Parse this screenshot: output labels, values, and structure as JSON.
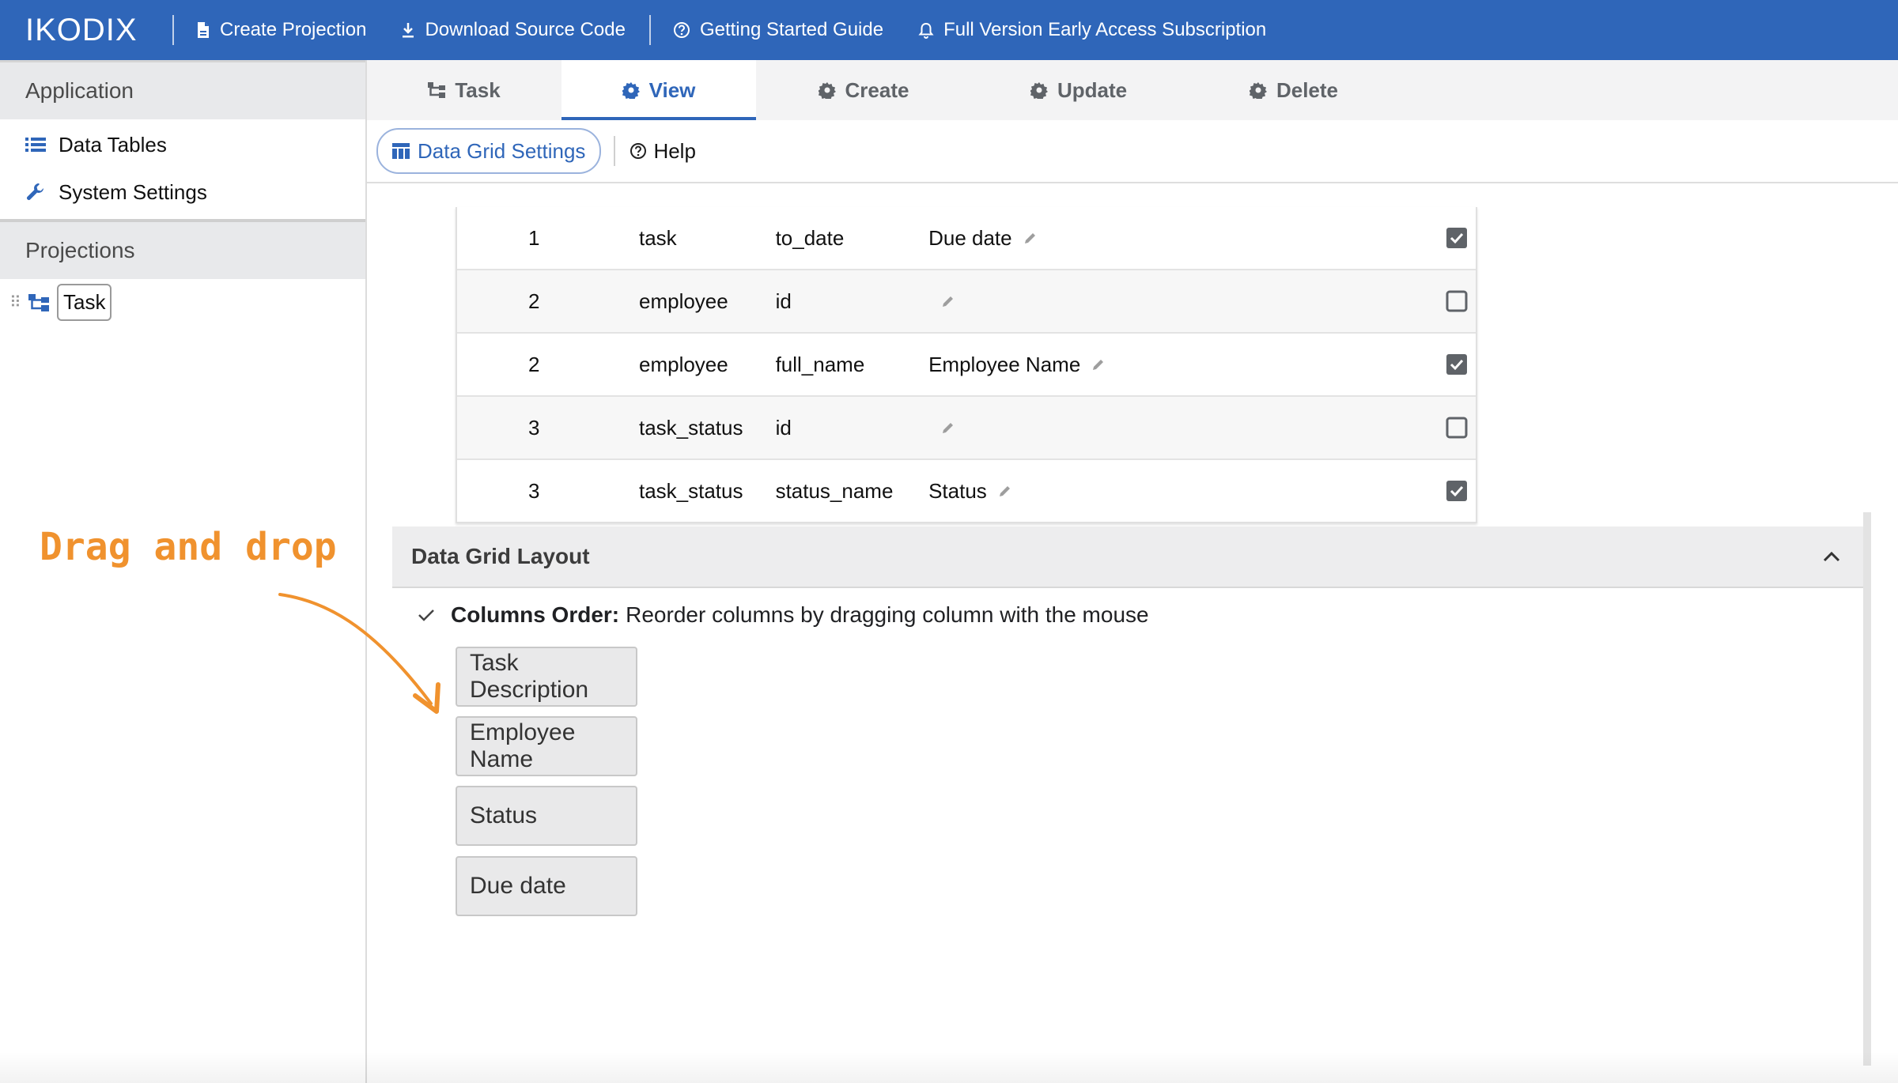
{
  "topbar": {
    "brand": "IKODIX",
    "create_projection": "Create Projection",
    "download_source": "Download Source Code",
    "getting_started": "Getting Started Guide",
    "full_version": "Full Version Early Access Subscription",
    "color": "#2f66b9"
  },
  "sidebar": {
    "application_header": "Application",
    "items": [
      {
        "label": "Data Tables",
        "icon": "list-icon"
      },
      {
        "label": "System Settings",
        "icon": "wrench-icon"
      }
    ],
    "projections_header": "Projections",
    "tree": [
      {
        "label": "Task",
        "icon": "hierarchy-icon"
      }
    ]
  },
  "tabs": [
    {
      "label": "Task",
      "icon": "hierarchy-icon"
    },
    {
      "label": "View",
      "icon": "gear-icon",
      "active": true
    },
    {
      "label": "Create",
      "icon": "gear-icon"
    },
    {
      "label": "Update",
      "icon": "gear-icon"
    },
    {
      "label": "Delete",
      "icon": "gear-icon"
    }
  ],
  "toolbar": {
    "grid_settings": "Data Grid Settings",
    "help": "Help"
  },
  "table": {
    "rows": [
      {
        "num": "1",
        "table": "task",
        "column": "to_date",
        "label": "Due date",
        "checked": true
      },
      {
        "num": "2",
        "table": "employee",
        "column": "id",
        "label": "",
        "checked": false
      },
      {
        "num": "2",
        "table": "employee",
        "column": "full_name",
        "label": "Employee Name",
        "checked": true
      },
      {
        "num": "3",
        "table": "task_status",
        "column": "id",
        "label": "",
        "checked": false
      },
      {
        "num": "3",
        "table": "task_status",
        "column": "status_name",
        "label": "Status",
        "checked": true
      }
    ]
  },
  "annotation": {
    "text": "Drag and drop",
    "color": "#f0922e"
  },
  "layout_panel": {
    "title": "Data Grid Layout",
    "order_bold": "Columns Order:",
    "order_text": "Reorder columns by dragging column with the mouse",
    "columns": [
      "Task Description",
      "Employee Name",
      "Status",
      "Due date"
    ]
  }
}
